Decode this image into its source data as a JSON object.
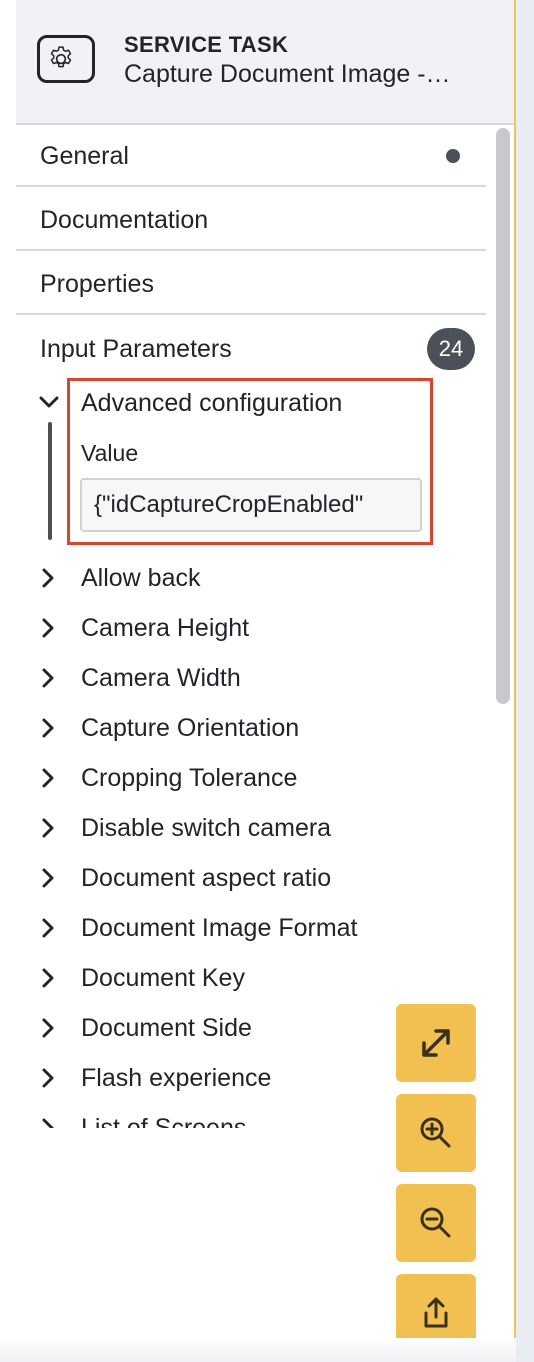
{
  "header": {
    "type_label": "SERVICE TASK",
    "element_name": "Capture Document Image -…",
    "icon": "gear-icon"
  },
  "groups": [
    {
      "label": "General",
      "has_indicator": true
    },
    {
      "label": "Documentation"
    },
    {
      "label": "Properties"
    }
  ],
  "input_parameters": {
    "label": "Input Parameters",
    "count": "24",
    "expanded_item": {
      "label": "Advanced configuration",
      "value_label": "Value",
      "value": "{\"idCaptureCropEnabled\""
    },
    "items": [
      "Allow back",
      "Camera Height",
      "Camera Width",
      "Capture Orientation",
      "Cropping Tolerance",
      "Disable switch camera",
      "Document aspect ratio",
      "Document Image Format",
      "Document Key",
      "Document Side",
      "Flash experience",
      "List of Screens"
    ]
  },
  "canvas_controls": [
    {
      "name": "fit-viewport-button",
      "icon": "expand-icon"
    },
    {
      "name": "zoom-in-button",
      "icon": "zoom-in-icon"
    },
    {
      "name": "zoom-out-button",
      "icon": "zoom-out-icon"
    },
    {
      "name": "export-button",
      "icon": "share-icon"
    }
  ],
  "colors": {
    "accent": "#f2c050",
    "highlight_border": "#d9462f",
    "badge": "#4c5058"
  }
}
